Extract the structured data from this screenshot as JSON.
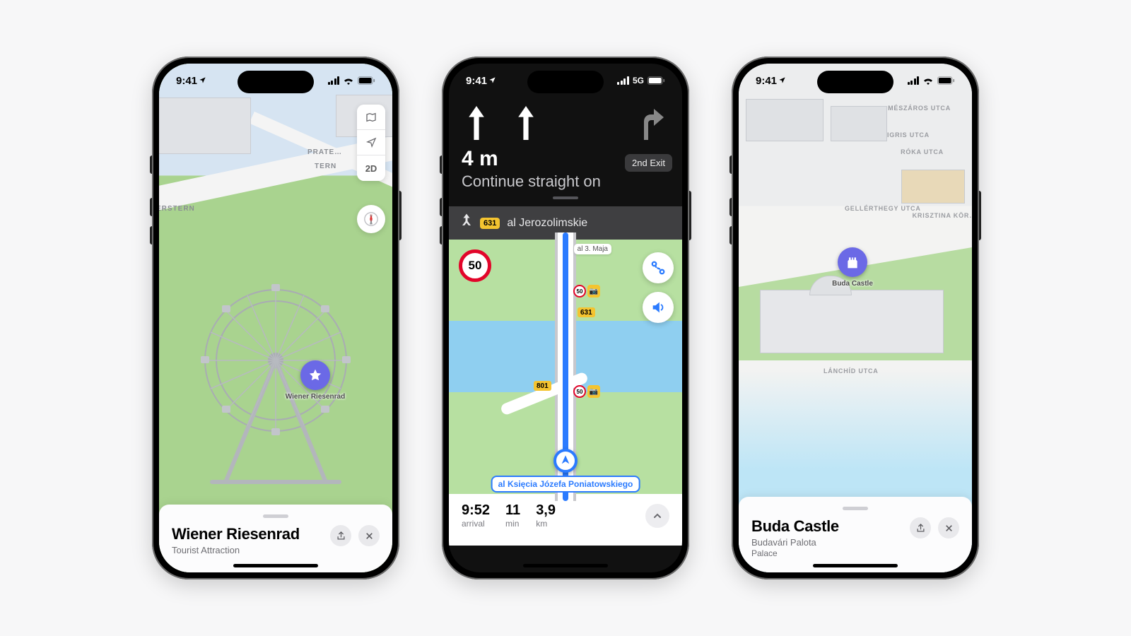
{
  "statusTime": "9:41",
  "phone1": {
    "cellular": "wifi",
    "controls": {
      "map": "",
      "locate": "",
      "mode": "2D"
    },
    "streetLabels": [
      "PRATE…",
      "ERSTERN",
      "TERN"
    ],
    "pinLabel": "Wiener Riesenrad",
    "card": {
      "title": "Wiener Riesenrad",
      "category": "Tourist Attraction"
    }
  },
  "phone2": {
    "cellular": "5G",
    "nav": {
      "distance": "4 m",
      "exit": "2nd Exit",
      "instruction": "Continue straight on",
      "nextRoad": "631",
      "nextStreet": "al Jerozolimskie"
    },
    "speedLimit": "50",
    "mapTags": {
      "top": "al 3. Maja"
    },
    "roadBadges": [
      "631",
      "801"
    ],
    "camSpeed": "50",
    "bottomRoad": "al Księcia Józefa Poniatowskiego",
    "trip": {
      "arrival": "9:52",
      "arrivalLabel": "arrival",
      "duration": "11",
      "durationLabel": "min",
      "distance": "3,9",
      "distanceLabel": "km"
    }
  },
  "phone3": {
    "cellular": "wifi",
    "pinLabel": "Buda Castle",
    "streetLabels": [
      "MÉSZÁROS UTCA",
      "TIGRIS UTCA",
      "RÓKA UTCA",
      "GELLÉRTHEGY UTCA",
      "KRISZTINA KÖR…",
      "LÁNCHÍD UTCA"
    ],
    "card": {
      "title": "Buda Castle",
      "subtitle": "Budavári Palota",
      "category": "Palace"
    }
  }
}
